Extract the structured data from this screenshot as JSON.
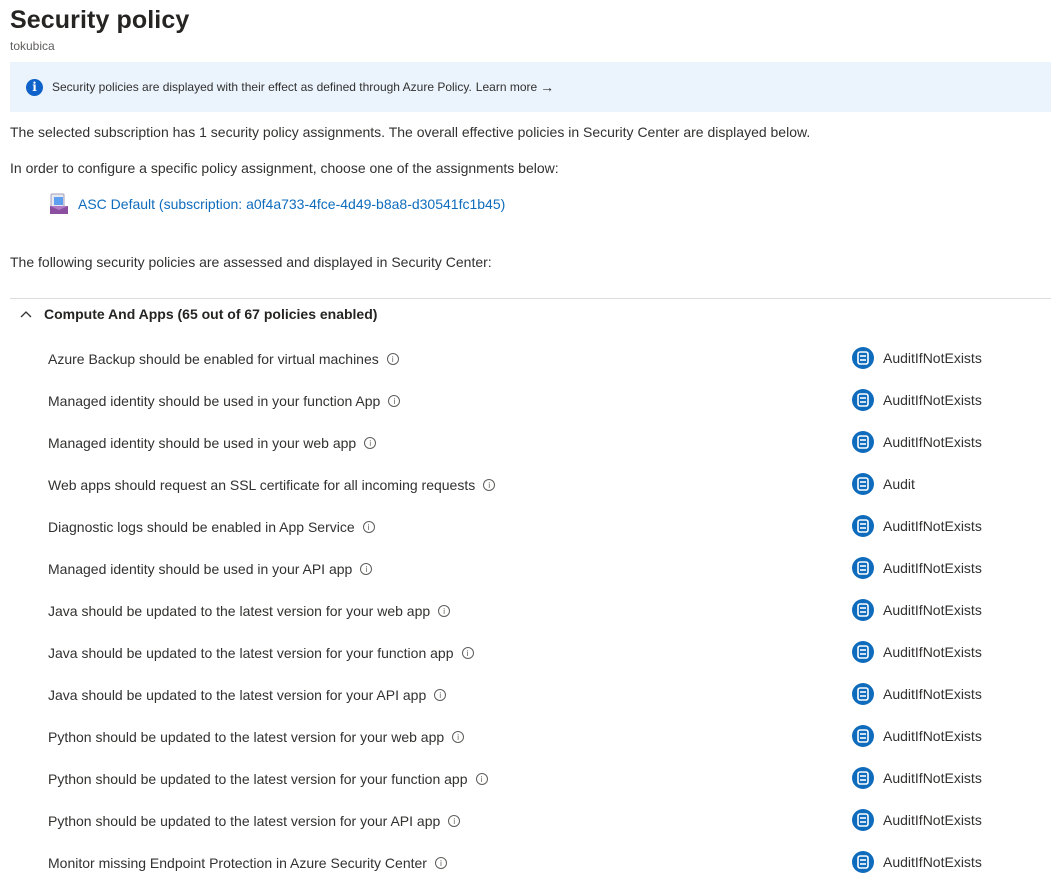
{
  "header": {
    "title": "Security policy",
    "subtitle": "tokubica"
  },
  "banner": {
    "icon": "info-icon",
    "text": "Security policies are displayed with their effect as defined through Azure Policy.",
    "link": "Learn more",
    "link_arrow": "→"
  },
  "body": {
    "summary": "The selected subscription has 1 security policy assignments. The overall effective policies in Security Center are displayed below.",
    "instruction": "In order to configure a specific policy assignment, choose one of the assignments below:",
    "assignment_link": "ASC Default (subscription: a0f4a733-4fce-4d49-b8a8-d30541fc1b45)",
    "following": "The following security policies are assessed and displayed in Security Center:"
  },
  "section": {
    "title": "Compute And Apps (65 out of 67 policies enabled)",
    "expanded": true,
    "policies": [
      {
        "name": "Azure Backup should be enabled for virtual machines",
        "effect": "AuditIfNotExists"
      },
      {
        "name": "Managed identity should be used in your function App",
        "effect": "AuditIfNotExists"
      },
      {
        "name": "Managed identity should be used in your web app",
        "effect": "AuditIfNotExists"
      },
      {
        "name": "Web apps should request an SSL certificate for all incoming requests",
        "effect": "Audit"
      },
      {
        "name": "Diagnostic logs should be enabled in App Service",
        "effect": "AuditIfNotExists"
      },
      {
        "name": "Managed identity should be used in your API app",
        "effect": "AuditIfNotExists"
      },
      {
        "name": "Java should be updated to the latest version for your web app",
        "effect": "AuditIfNotExists"
      },
      {
        "name": "Java should be updated to the latest version for your function app",
        "effect": "AuditIfNotExists"
      },
      {
        "name": "Java should be updated to the latest version for your API app",
        "effect": "AuditIfNotExists"
      },
      {
        "name": "Python should be updated to the latest version for your web app",
        "effect": "AuditIfNotExists"
      },
      {
        "name": "Python should be updated to the latest version for your function app",
        "effect": "AuditIfNotExists"
      },
      {
        "name": "Python should be updated to the latest version for your API app",
        "effect": "AuditIfNotExists"
      },
      {
        "name": "Monitor missing Endpoint Protection in Azure Security Center",
        "effect": "AuditIfNotExists"
      }
    ]
  },
  "colors": {
    "link": "#0f6cbd",
    "banner_bg": "#ebf3fc",
    "info_icon": "#0f62c9",
    "effect_icon": "#0f6cbd"
  }
}
